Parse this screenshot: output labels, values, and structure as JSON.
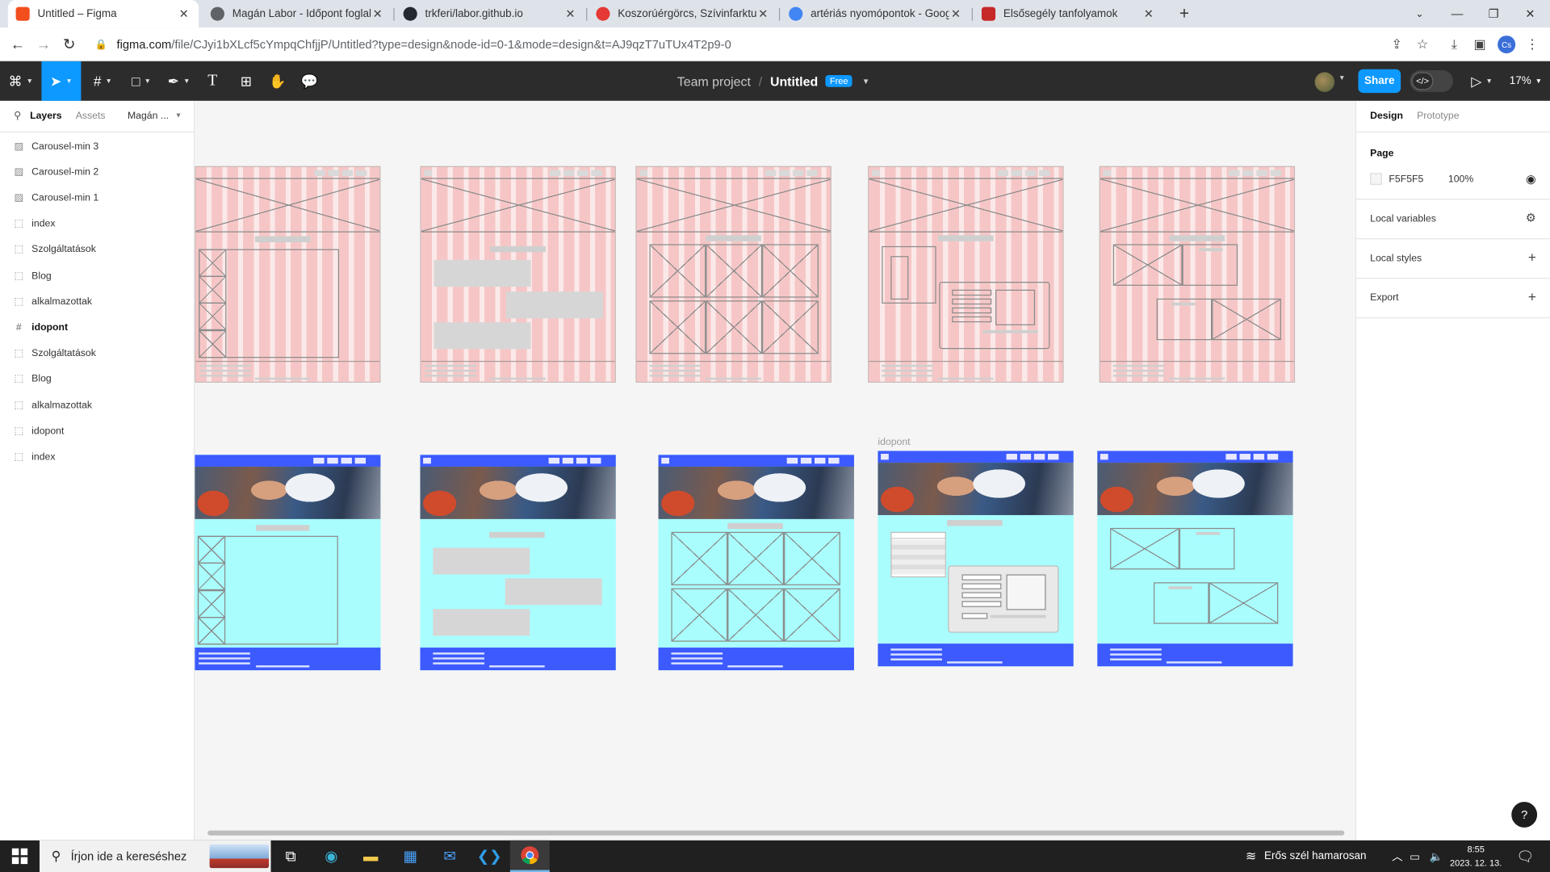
{
  "browser": {
    "tabs": [
      {
        "title": "Untitled – Figma",
        "favicon_color": "#f24e1e",
        "active": true
      },
      {
        "title": "Magán Labor - Időpont foglalás",
        "favicon_color": "#5f6368",
        "active": false
      },
      {
        "title": "trkferi/labor.github.io",
        "favicon_color": "#24292f",
        "active": false
      },
      {
        "title": "Koszorúérgörcs, Szívinfarktus - I",
        "favicon_color": "#e53935",
        "active": false
      },
      {
        "title": "artériás nyomópontok - Google",
        "favicon_color": "#4285f4",
        "active": false
      },
      {
        "title": "Elsősegély tanfolyamok",
        "favicon_color": "#c62828",
        "active": false
      }
    ],
    "new_tab": "+",
    "url_main": "figma.com",
    "url_rest": "/file/CJyi1bXLcf5cYmpqChfjjP/Untitled?type=design&node-id=0-1&mode=design&t=AJ9qzT7uTUx4T2p9-0",
    "profile_initials": "Cs"
  },
  "figma": {
    "team": "Team project",
    "file_name": "Untitled",
    "plan_badge": "Free",
    "share_label": "Share",
    "zoom": "17%",
    "left_tabs": {
      "layers": "Layers",
      "assets": "Assets",
      "page": "Magán ..."
    },
    "layers": [
      {
        "name": "Carousel-min 3",
        "icon": "image-icon",
        "bold": false
      },
      {
        "name": "Carousel-min 2",
        "icon": "image-icon",
        "bold": false
      },
      {
        "name": "Carousel-min 1",
        "icon": "image-icon",
        "bold": false
      },
      {
        "name": "index",
        "icon": "frame-dashed-icon",
        "bold": false
      },
      {
        "name": "Szolgáltatások",
        "icon": "frame-dashed-icon",
        "bold": false
      },
      {
        "name": "Blog",
        "icon": "frame-dashed-icon",
        "bold": false
      },
      {
        "name": "alkalmazottak",
        "icon": "frame-dashed-icon",
        "bold": false
      },
      {
        "name": "idopont",
        "icon": "frame-hash-icon",
        "bold": true
      },
      {
        "name": "Szolgáltatások",
        "icon": "frame-dashed-icon",
        "bold": false
      },
      {
        "name": "Blog",
        "icon": "frame-dashed-icon",
        "bold": false
      },
      {
        "name": "alkalmazottak",
        "icon": "frame-dashed-icon",
        "bold": false
      },
      {
        "name": "idopont",
        "icon": "frame-dashed-icon",
        "bold": false
      },
      {
        "name": "index",
        "icon": "frame-dashed-icon",
        "bold": false
      }
    ],
    "canvas_label": "idopont",
    "right_tabs": {
      "design": "Design",
      "prototype": "Prototype"
    },
    "page_section": {
      "title": "Page",
      "fill_hex": "F5F5F5",
      "opacity": "100%"
    },
    "sections": [
      "Local variables",
      "Local styles",
      "Export"
    ],
    "help": "?",
    "colors": {
      "wireframe_bg": "#fbe9e9",
      "grid_columns": "#f2aaaa",
      "mockup_bg": "#a9fdfd",
      "mockup_bar": "#3d5afe",
      "accent": "#0d99ff"
    }
  },
  "taskbar": {
    "search_placeholder": "Írjon ide a kereséshez",
    "weather": "Erős szél hamarosan",
    "time": "8:55",
    "date": "2023. 12. 13."
  }
}
